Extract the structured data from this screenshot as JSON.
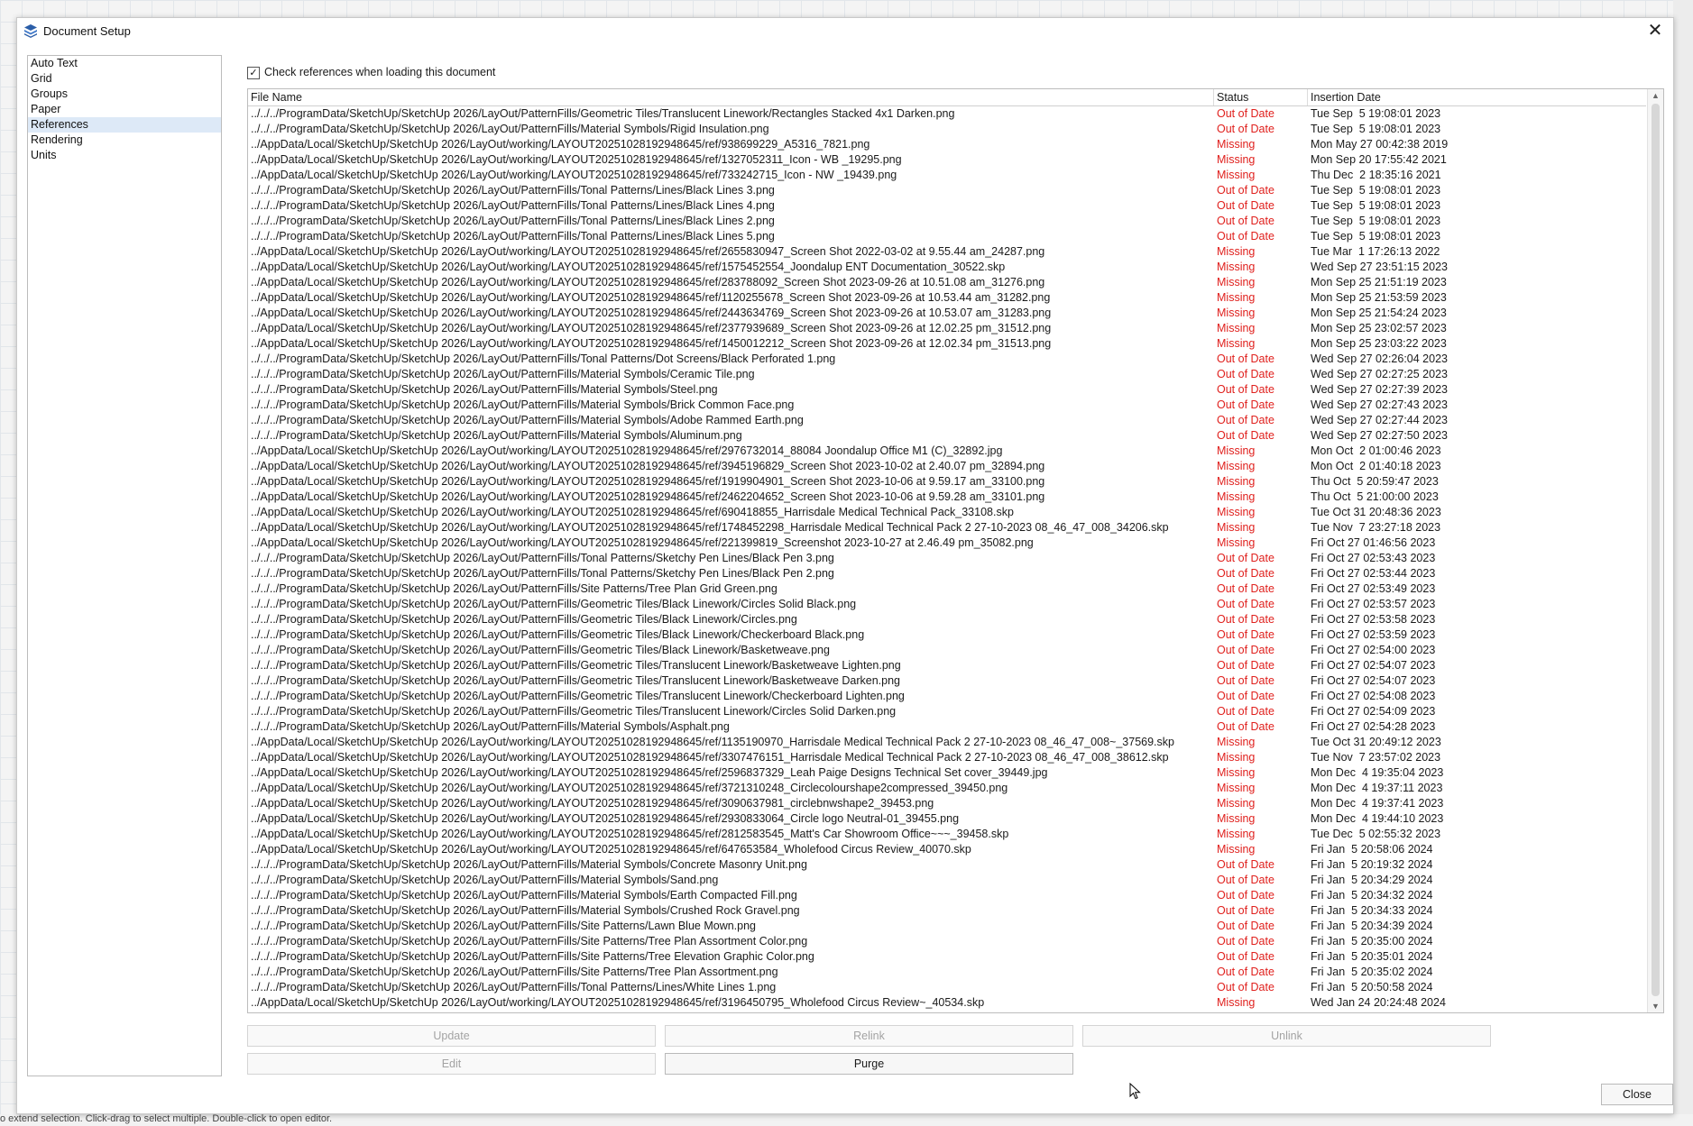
{
  "window": {
    "title": "Document Setup",
    "close_glyph": "✕"
  },
  "sidebar": {
    "items": [
      {
        "label": "Auto Text"
      },
      {
        "label": "Grid"
      },
      {
        "label": "Groups"
      },
      {
        "label": "Paper"
      },
      {
        "label": "References",
        "selected": true
      },
      {
        "label": "Rendering"
      },
      {
        "label": "Units"
      }
    ]
  },
  "check_references": {
    "label": "Check references when loading this document",
    "checked": true,
    "glyph": "✓"
  },
  "table": {
    "headers": {
      "file": "File Name",
      "status": "Status",
      "date": "Insertion Date"
    },
    "rows": [
      {
        "file": "../../../ProgramData/SketchUp/SketchUp 2026/LayOut/PatternFills/Geometric Tiles/Translucent Linework/Rectangles Stacked 4x1 Darken.png",
        "status": "Out of Date",
        "date": "Tue Sep  5 19:08:01 2023"
      },
      {
        "file": "../../../ProgramData/SketchUp/SketchUp 2026/LayOut/PatternFills/Material Symbols/Rigid Insulation.png",
        "status": "Out of Date",
        "date": "Tue Sep  5 19:08:01 2023"
      },
      {
        "file": "../AppData/Local/SketchUp/SketchUp 2026/LayOut/working/LAYOUT20251028192948645/ref/938699229_A5316_7821.png",
        "status": "Missing",
        "date": "Mon May 27 00:42:38 2019"
      },
      {
        "file": "../AppData/Local/SketchUp/SketchUp 2026/LayOut/working/LAYOUT20251028192948645/ref/1327052311_Icon - WB _19295.png",
        "status": "Missing",
        "date": "Mon Sep 20 17:55:42 2021"
      },
      {
        "file": "../AppData/Local/SketchUp/SketchUp 2026/LayOut/working/LAYOUT20251028192948645/ref/733242715_Icon - NW _19439.png",
        "status": "Missing",
        "date": "Thu Dec  2 18:35:16 2021"
      },
      {
        "file": "../../../ProgramData/SketchUp/SketchUp 2026/LayOut/PatternFills/Tonal Patterns/Lines/Black Lines 3.png",
        "status": "Out of Date",
        "date": "Tue Sep  5 19:08:01 2023"
      },
      {
        "file": "../../../ProgramData/SketchUp/SketchUp 2026/LayOut/PatternFills/Tonal Patterns/Lines/Black Lines 4.png",
        "status": "Out of Date",
        "date": "Tue Sep  5 19:08:01 2023"
      },
      {
        "file": "../../../ProgramData/SketchUp/SketchUp 2026/LayOut/PatternFills/Tonal Patterns/Lines/Black Lines 2.png",
        "status": "Out of Date",
        "date": "Tue Sep  5 19:08:01 2023"
      },
      {
        "file": "../../../ProgramData/SketchUp/SketchUp 2026/LayOut/PatternFills/Tonal Patterns/Lines/Black Lines 5.png",
        "status": "Out of Date",
        "date": "Tue Sep  5 19:08:01 2023"
      },
      {
        "file": "../AppData/Local/SketchUp/SketchUp 2026/LayOut/working/LAYOUT20251028192948645/ref/2655830947_Screen Shot 2022-03-02 at 9.55.44 am_24287.png",
        "status": "Missing",
        "date": "Tue Mar  1 17:26:13 2022"
      },
      {
        "file": "../AppData/Local/SketchUp/SketchUp 2026/LayOut/working/LAYOUT20251028192948645/ref/1575452554_Joondalup ENT Documentation_30522.skp",
        "status": "Missing",
        "date": "Wed Sep 27 23:51:15 2023"
      },
      {
        "file": "../AppData/Local/SketchUp/SketchUp 2026/LayOut/working/LAYOUT20251028192948645/ref/283788092_Screen Shot 2023-09-26 at 10.51.08 am_31276.png",
        "status": "Missing",
        "date": "Mon Sep 25 21:51:19 2023"
      },
      {
        "file": "../AppData/Local/SketchUp/SketchUp 2026/LayOut/working/LAYOUT20251028192948645/ref/1120255678_Screen Shot 2023-09-26 at 10.53.44 am_31282.png",
        "status": "Missing",
        "date": "Mon Sep 25 21:53:59 2023"
      },
      {
        "file": "../AppData/Local/SketchUp/SketchUp 2026/LayOut/working/LAYOUT20251028192948645/ref/2443634769_Screen Shot 2023-09-26 at 10.53.07 am_31283.png",
        "status": "Missing",
        "date": "Mon Sep 25 21:54:24 2023"
      },
      {
        "file": "../AppData/Local/SketchUp/SketchUp 2026/LayOut/working/LAYOUT20251028192948645/ref/2377939689_Screen Shot 2023-09-26 at 12.02.25 pm_31512.png",
        "status": "Missing",
        "date": "Mon Sep 25 23:02:57 2023"
      },
      {
        "file": "../AppData/Local/SketchUp/SketchUp 2026/LayOut/working/LAYOUT20251028192948645/ref/1450012212_Screen Shot 2023-09-26 at 12.02.34 pm_31513.png",
        "status": "Missing",
        "date": "Mon Sep 25 23:03:22 2023"
      },
      {
        "file": "../../../ProgramData/SketchUp/SketchUp 2026/LayOut/PatternFills/Tonal Patterns/Dot Screens/Black Perforated 1.png",
        "status": "Out of Date",
        "date": "Wed Sep 27 02:26:04 2023"
      },
      {
        "file": "../../../ProgramData/SketchUp/SketchUp 2026/LayOut/PatternFills/Material Symbols/Ceramic Tile.png",
        "status": "Out of Date",
        "date": "Wed Sep 27 02:27:25 2023"
      },
      {
        "file": "../../../ProgramData/SketchUp/SketchUp 2026/LayOut/PatternFills/Material Symbols/Steel.png",
        "status": "Out of Date",
        "date": "Wed Sep 27 02:27:39 2023"
      },
      {
        "file": "../../../ProgramData/SketchUp/SketchUp 2026/LayOut/PatternFills/Material Symbols/Brick Common Face.png",
        "status": "Out of Date",
        "date": "Wed Sep 27 02:27:43 2023"
      },
      {
        "file": "../../../ProgramData/SketchUp/SketchUp 2026/LayOut/PatternFills/Material Symbols/Adobe Rammed Earth.png",
        "status": "Out of Date",
        "date": "Wed Sep 27 02:27:44 2023"
      },
      {
        "file": "../../../ProgramData/SketchUp/SketchUp 2026/LayOut/PatternFills/Material Symbols/Aluminum.png",
        "status": "Out of Date",
        "date": "Wed Sep 27 02:27:50 2023"
      },
      {
        "file": "../AppData/Local/SketchUp/SketchUp 2026/LayOut/working/LAYOUT20251028192948645/ref/2976732014_88084 Joondalup Office M1 (C)_32892.jpg",
        "status": "Missing",
        "date": "Mon Oct  2 01:00:46 2023"
      },
      {
        "file": "../AppData/Local/SketchUp/SketchUp 2026/LayOut/working/LAYOUT20251028192948645/ref/3945196829_Screen Shot 2023-10-02 at 2.40.07 pm_32894.png",
        "status": "Missing",
        "date": "Mon Oct  2 01:40:18 2023"
      },
      {
        "file": "../AppData/Local/SketchUp/SketchUp 2026/LayOut/working/LAYOUT20251028192948645/ref/1919904901_Screen Shot 2023-10-06 at 9.59.17 am_33100.png",
        "status": "Missing",
        "date": "Thu Oct  5 20:59:47 2023"
      },
      {
        "file": "../AppData/Local/SketchUp/SketchUp 2026/LayOut/working/LAYOUT20251028192948645/ref/2462204652_Screen Shot 2023-10-06 at 9.59.28 am_33101.png",
        "status": "Missing",
        "date": "Thu Oct  5 21:00:00 2023"
      },
      {
        "file": "../AppData/Local/SketchUp/SketchUp 2026/LayOut/working/LAYOUT20251028192948645/ref/690418855_Harrisdale Medical Technical Pack_33108.skp",
        "status": "Missing",
        "date": "Tue Oct 31 20:48:36 2023"
      },
      {
        "file": "../AppData/Local/SketchUp/SketchUp 2026/LayOut/working/LAYOUT20251028192948645/ref/1748452298_Harrisdale Medical Technical Pack 2 27-10-2023 08_46_47_008_34206.skp",
        "status": "Missing",
        "date": "Tue Nov  7 23:27:18 2023"
      },
      {
        "file": "../AppData/Local/SketchUp/SketchUp 2026/LayOut/working/LAYOUT20251028192948645/ref/221399819_Screenshot 2023-10-27 at 2.46.49 pm_35082.png",
        "status": "Missing",
        "date": "Fri Oct 27 01:46:56 2023"
      },
      {
        "file": "../../../ProgramData/SketchUp/SketchUp 2026/LayOut/PatternFills/Tonal Patterns/Sketchy Pen Lines/Black Pen 3.png",
        "status": "Out of Date",
        "date": "Fri Oct 27 02:53:43 2023"
      },
      {
        "file": "../../../ProgramData/SketchUp/SketchUp 2026/LayOut/PatternFills/Tonal Patterns/Sketchy Pen Lines/Black Pen 2.png",
        "status": "Out of Date",
        "date": "Fri Oct 27 02:53:44 2023"
      },
      {
        "file": "../../../ProgramData/SketchUp/SketchUp 2026/LayOut/PatternFills/Site Patterns/Tree Plan Grid Green.png",
        "status": "Out of Date",
        "date": "Fri Oct 27 02:53:49 2023"
      },
      {
        "file": "../../../ProgramData/SketchUp/SketchUp 2026/LayOut/PatternFills/Geometric Tiles/Black Linework/Circles Solid Black.png",
        "status": "Out of Date",
        "date": "Fri Oct 27 02:53:57 2023"
      },
      {
        "file": "../../../ProgramData/SketchUp/SketchUp 2026/LayOut/PatternFills/Geometric Tiles/Black Linework/Circles.png",
        "status": "Out of Date",
        "date": "Fri Oct 27 02:53:58 2023"
      },
      {
        "file": "../../../ProgramData/SketchUp/SketchUp 2026/LayOut/PatternFills/Geometric Tiles/Black Linework/Checkerboard Black.png",
        "status": "Out of Date",
        "date": "Fri Oct 27 02:53:59 2023"
      },
      {
        "file": "../../../ProgramData/SketchUp/SketchUp 2026/LayOut/PatternFills/Geometric Tiles/Black Linework/Basketweave.png",
        "status": "Out of Date",
        "date": "Fri Oct 27 02:54:00 2023"
      },
      {
        "file": "../../../ProgramData/SketchUp/SketchUp 2026/LayOut/PatternFills/Geometric Tiles/Translucent Linework/Basketweave Lighten.png",
        "status": "Out of Date",
        "date": "Fri Oct 27 02:54:07 2023"
      },
      {
        "file": "../../../ProgramData/SketchUp/SketchUp 2026/LayOut/PatternFills/Geometric Tiles/Translucent Linework/Basketweave Darken.png",
        "status": "Out of Date",
        "date": "Fri Oct 27 02:54:07 2023"
      },
      {
        "file": "../../../ProgramData/SketchUp/SketchUp 2026/LayOut/PatternFills/Geometric Tiles/Translucent Linework/Checkerboard Lighten.png",
        "status": "Out of Date",
        "date": "Fri Oct 27 02:54:08 2023"
      },
      {
        "file": "../../../ProgramData/SketchUp/SketchUp 2026/LayOut/PatternFills/Geometric Tiles/Translucent Linework/Circles Solid Darken.png",
        "status": "Out of Date",
        "date": "Fri Oct 27 02:54:09 2023"
      },
      {
        "file": "../../../ProgramData/SketchUp/SketchUp 2026/LayOut/PatternFills/Material Symbols/Asphalt.png",
        "status": "Out of Date",
        "date": "Fri Oct 27 02:54:28 2023"
      },
      {
        "file": "../AppData/Local/SketchUp/SketchUp 2026/LayOut/working/LAYOUT20251028192948645/ref/1135190970_Harrisdale Medical Technical Pack 2 27-10-2023 08_46_47_008~_37569.skp",
        "status": "Missing",
        "date": "Tue Oct 31 20:49:12 2023"
      },
      {
        "file": "../AppData/Local/SketchUp/SketchUp 2026/LayOut/working/LAYOUT20251028192948645/ref/3307476151_Harrisdale Medical Technical Pack 2 27-10-2023 08_46_47_008_38612.skp",
        "status": "Missing",
        "date": "Tue Nov  7 23:57:02 2023"
      },
      {
        "file": "../AppData/Local/SketchUp/SketchUp 2026/LayOut/working/LAYOUT20251028192948645/ref/2596837329_Leah Paige Designs Technical Set cover_39449.jpg",
        "status": "Missing",
        "date": "Mon Dec  4 19:35:04 2023"
      },
      {
        "file": "../AppData/Local/SketchUp/SketchUp 2026/LayOut/working/LAYOUT20251028192948645/ref/3721310248_Circlecolourshape2compressed_39450.png",
        "status": "Missing",
        "date": "Mon Dec  4 19:37:11 2023"
      },
      {
        "file": "../AppData/Local/SketchUp/SketchUp 2026/LayOut/working/LAYOUT20251028192948645/ref/3090637981_circlebnwshape2_39453.png",
        "status": "Missing",
        "date": "Mon Dec  4 19:37:41 2023"
      },
      {
        "file": "../AppData/Local/SketchUp/SketchUp 2026/LayOut/working/LAYOUT20251028192948645/ref/2930833064_Circle logo Neutral-01_39455.png",
        "status": "Missing",
        "date": "Mon Dec  4 19:44:10 2023"
      },
      {
        "file": "../AppData/Local/SketchUp/SketchUp 2026/LayOut/working/LAYOUT20251028192948645/ref/2812583545_Matt's Car Showroom Office~~~_39458.skp",
        "status": "Missing",
        "date": "Tue Dec  5 02:55:32 2023"
      },
      {
        "file": "../AppData/Local/SketchUp/SketchUp 2026/LayOut/working/LAYOUT20251028192948645/ref/647653584_Wholefood Circus Review_40070.skp",
        "status": "Missing",
        "date": "Fri Jan  5 20:58:06 2024"
      },
      {
        "file": "../../../ProgramData/SketchUp/SketchUp 2026/LayOut/PatternFills/Material Symbols/Concrete Masonry Unit.png",
        "status": "Out of Date",
        "date": "Fri Jan  5 20:19:32 2024"
      },
      {
        "file": "../../../ProgramData/SketchUp/SketchUp 2026/LayOut/PatternFills/Material Symbols/Sand.png",
        "status": "Out of Date",
        "date": "Fri Jan  5 20:34:29 2024"
      },
      {
        "file": "../../../ProgramData/SketchUp/SketchUp 2026/LayOut/PatternFills/Material Symbols/Earth Compacted Fill.png",
        "status": "Out of Date",
        "date": "Fri Jan  5 20:34:32 2024"
      },
      {
        "file": "../../../ProgramData/SketchUp/SketchUp 2026/LayOut/PatternFills/Material Symbols/Crushed Rock Gravel.png",
        "status": "Out of Date",
        "date": "Fri Jan  5 20:34:33 2024"
      },
      {
        "file": "../../../ProgramData/SketchUp/SketchUp 2026/LayOut/PatternFills/Site Patterns/Lawn Blue Mown.png",
        "status": "Out of Date",
        "date": "Fri Jan  5 20:34:39 2024"
      },
      {
        "file": "../../../ProgramData/SketchUp/SketchUp 2026/LayOut/PatternFills/Site Patterns/Tree Plan Assortment Color.png",
        "status": "Out of Date",
        "date": "Fri Jan  5 20:35:00 2024"
      },
      {
        "file": "../../../ProgramData/SketchUp/SketchUp 2026/LayOut/PatternFills/Site Patterns/Tree Elevation Graphic Color.png",
        "status": "Out of Date",
        "date": "Fri Jan  5 20:35:01 2024"
      },
      {
        "file": "../../../ProgramData/SketchUp/SketchUp 2026/LayOut/PatternFills/Site Patterns/Tree Plan Assortment.png",
        "status": "Out of Date",
        "date": "Fri Jan  5 20:35:02 2024"
      },
      {
        "file": "../../../ProgramData/SketchUp/SketchUp 2026/LayOut/PatternFills/Tonal Patterns/Lines/White Lines 1.png",
        "status": "Out of Date",
        "date": "Fri Jan  5 20:50:58 2024"
      },
      {
        "file": "../AppData/Local/SketchUp/SketchUp 2026/LayOut/working/LAYOUT20251028192948645/ref/3196450795_Wholefood Circus Review~_40534.skp",
        "status": "Missing",
        "date": "Wed Jan 24 20:24:48 2024"
      }
    ]
  },
  "buttons": {
    "update": "Update",
    "relink": "Relink",
    "unlink": "Unlink",
    "edit": "Edit",
    "purge": "Purge",
    "close": "Close"
  },
  "status_bar": {
    "text": "o extend selection. Click-drag to select multiple. Double-click to open editor."
  },
  "colors": {
    "status_red": "#e0201d",
    "selection": "#dde9f7",
    "icon_blue": "#2b5ea8"
  },
  "icons": {
    "app": "app-icon",
    "close": "close-icon",
    "scroll_up": "scroll-up-icon",
    "scroll_down": "scroll-down-icon",
    "cursor": "mouse-cursor-icon"
  }
}
